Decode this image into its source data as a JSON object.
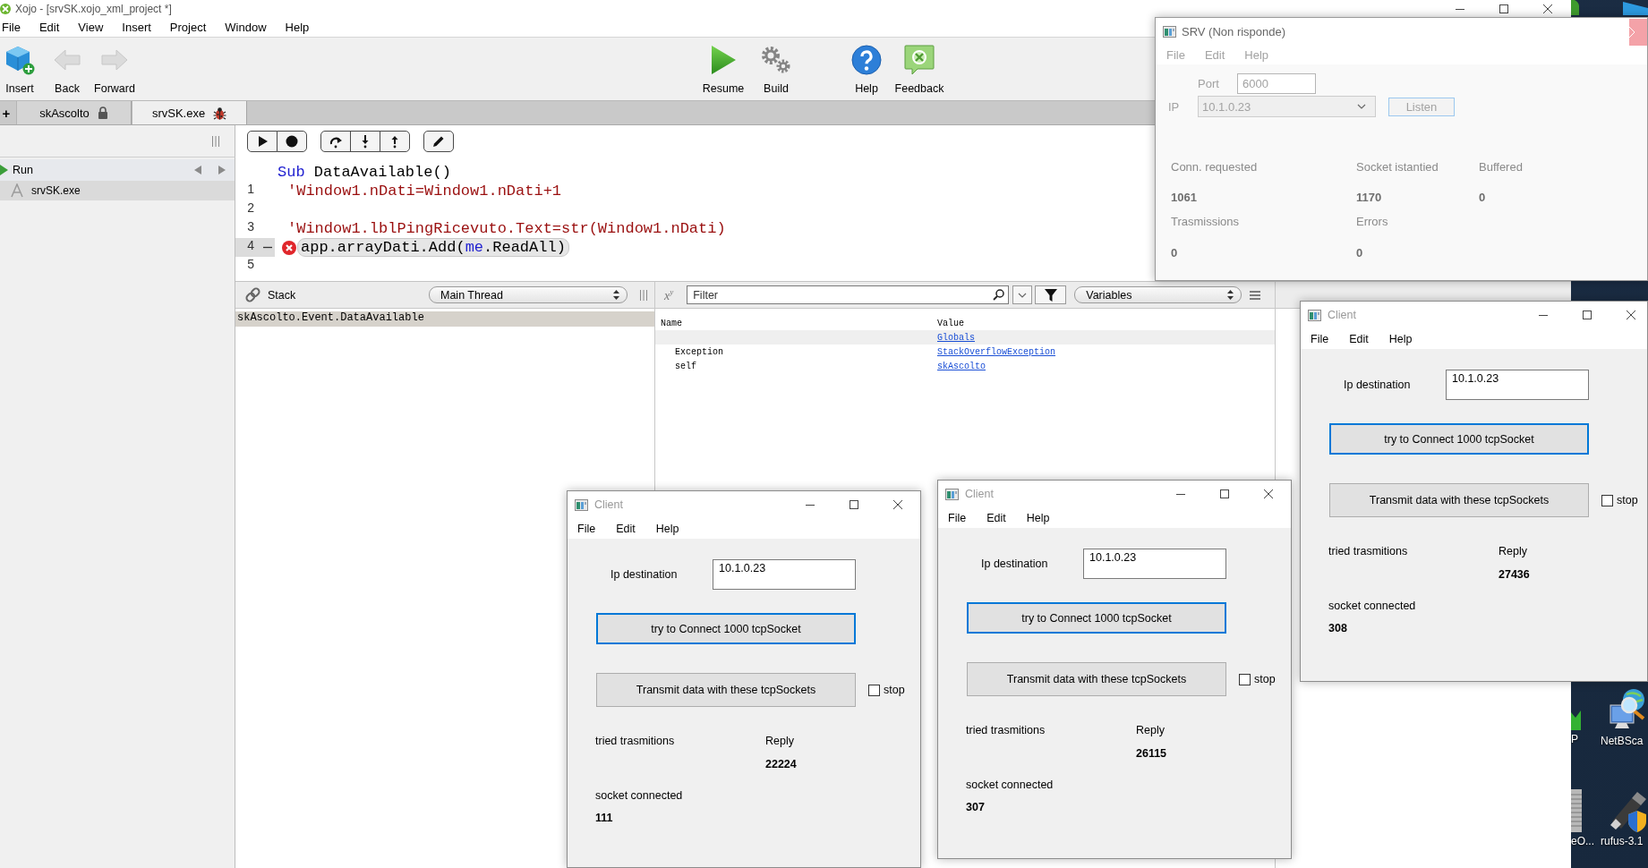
{
  "ide_window": {
    "title": "Xojo - [srvSK.xojo_xml_project *]",
    "menu": [
      "File",
      "Edit",
      "View",
      "Insert",
      "Project",
      "Window",
      "Help"
    ],
    "toolbar": {
      "left": [
        {
          "label": "Insert",
          "kind": "insert",
          "disabled": false
        },
        {
          "label": "Back",
          "kind": "back",
          "disabled": true
        },
        {
          "label": "Forward",
          "kind": "forward",
          "disabled": true
        }
      ],
      "run": [
        {
          "label": "Resume",
          "kind": "resume",
          "disabled": false
        },
        {
          "label": "Build",
          "kind": "build",
          "disabled": false
        }
      ],
      "help": [
        {
          "label": "Help",
          "kind": "help",
          "disabled": false
        },
        {
          "label": "Feedback",
          "kind": "feedback",
          "disabled": false
        }
      ]
    },
    "new_tab": "+",
    "tabs": [
      {
        "label": "skAscolto",
        "kind": "locked",
        "selected": false
      },
      {
        "label": "srvSK.exe",
        "kind": "debugging",
        "selected": true
      }
    ],
    "navigator": {
      "header": "Run",
      "items": [
        {
          "label": "srvSK.exe",
          "selected": true
        }
      ]
    },
    "code": {
      "signature": [
        {
          "text": "Sub",
          "kind": "keyword"
        },
        {
          "text": " DataAvailable()",
          "kind": "plain"
        }
      ],
      "lines": [
        {
          "number": "1",
          "current": false,
          "error": false,
          "segments": [
            {
              "text": "'Window1.nDati=Window1.nDati+1",
              "kind": "comment"
            }
          ]
        },
        {
          "number": "2",
          "current": false,
          "error": false
        },
        {
          "number": "3",
          "current": false,
          "error": false,
          "segments": [
            {
              "text": "'Window1.lblPingRicevuto.Text=str(Window1.nDati)",
              "kind": "comment"
            }
          ]
        },
        {
          "number": "4",
          "current": true,
          "error": true,
          "segments": [
            {
              "text": "app.arrayDati.Add(",
              "kind": "plain"
            },
            {
              "text": "me",
              "kind": "keyword"
            },
            {
              "text": ".ReadAll)",
              "kind": "plain"
            }
          ]
        },
        {
          "number": "5",
          "current": false,
          "error": false
        }
      ]
    },
    "stack": {
      "title": "Stack",
      "thread": "Main Thread",
      "frames": [
        {
          "label": "skAscolto.Event.DataAvailable",
          "selected": true
        }
      ]
    },
    "variables": {
      "format_toggle": "x$^{y}$",
      "filter": {
        "placeholder": "Filter"
      },
      "scope": "Variables",
      "columns": [
        "Name",
        "Value"
      ],
      "rows": [
        {
          "value": "Globals",
          "selected": true
        },
        {
          "name": "Exception",
          "value": "StackOverflowException",
          "selected": false
        },
        {
          "name": "self",
          "value": "skAscolto",
          "selected": false
        }
      ]
    }
  },
  "srv_window": {
    "title": "SRV (Non risponde)",
    "responding": false,
    "menu": [
      "File",
      "Edit",
      "Help"
    ],
    "port": {
      "label": "Port",
      "value": "6000"
    },
    "ip": {
      "label": "IP",
      "value": "10.1.0.23"
    },
    "listen_button": "Listen",
    "stats": [
      {
        "label": "Conn. requested",
        "value": "1061"
      },
      {
        "label": "Socket istantied",
        "value": "1170"
      },
      {
        "label": "Buffered",
        "value": "0"
      },
      {
        "label": "Trasmissions",
        "value": "0"
      },
      {
        "label": "Errors",
        "value": "0"
      }
    ]
  },
  "client_windows": [
    {
      "title": "Client",
      "menu": [
        "File",
        "Edit",
        "Help"
      ],
      "ip_label": "Ip destination",
      "ip_value": "10.1.0.23",
      "buttons": [
        {
          "label": "try to Connect 1000 tcpSocket",
          "focused": true
        },
        {
          "label": "Transmit data with these tcpSockets",
          "focused": false
        }
      ],
      "stop": {
        "label": "stop",
        "checked": false
      },
      "tried_label": "tried trasmitions",
      "reply_label": "Reply",
      "reply_value": "22224",
      "connected_label": "socket connected",
      "connected_value": "111"
    },
    {
      "title": "Client",
      "menu": [
        "File",
        "Edit",
        "Help"
      ],
      "ip_label": "Ip destination",
      "ip_value": "10.1.0.23",
      "buttons": [
        {
          "label": "try to Connect 1000 tcpSocket",
          "focused": true
        },
        {
          "label": "Transmit data with these tcpSockets",
          "focused": false
        }
      ],
      "stop": {
        "label": "stop",
        "checked": false
      },
      "tried_label": "tried trasmitions",
      "reply_label": "Reply",
      "reply_value": "26115",
      "connected_label": "socket connected",
      "connected_value": "307"
    },
    {
      "title": "Client",
      "menu": [
        "File",
        "Edit",
        "Help"
      ],
      "ip_label": "Ip destination",
      "ip_value": "10.1.0.23",
      "buttons": [
        {
          "label": "try to Connect 1000 tcpSocket",
          "focused": true
        },
        {
          "label": "Transmit data with these tcpSockets",
          "focused": false
        }
      ],
      "stop": {
        "label": "stop",
        "checked": false
      },
      "tried_label": "tried trasmitions",
      "reply_label": "Reply",
      "reply_value": "27436",
      "connected_label": "socket connected",
      "connected_value": "308"
    }
  ],
  "desktop_icons": [
    {
      "label": "P",
      "kind": "security"
    },
    {
      "label": "NetBSca",
      "kind": "scanner"
    },
    {
      "label": "eO...",
      "kind": "server"
    },
    {
      "label": "rufus-3.1",
      "kind": "usb"
    }
  ]
}
